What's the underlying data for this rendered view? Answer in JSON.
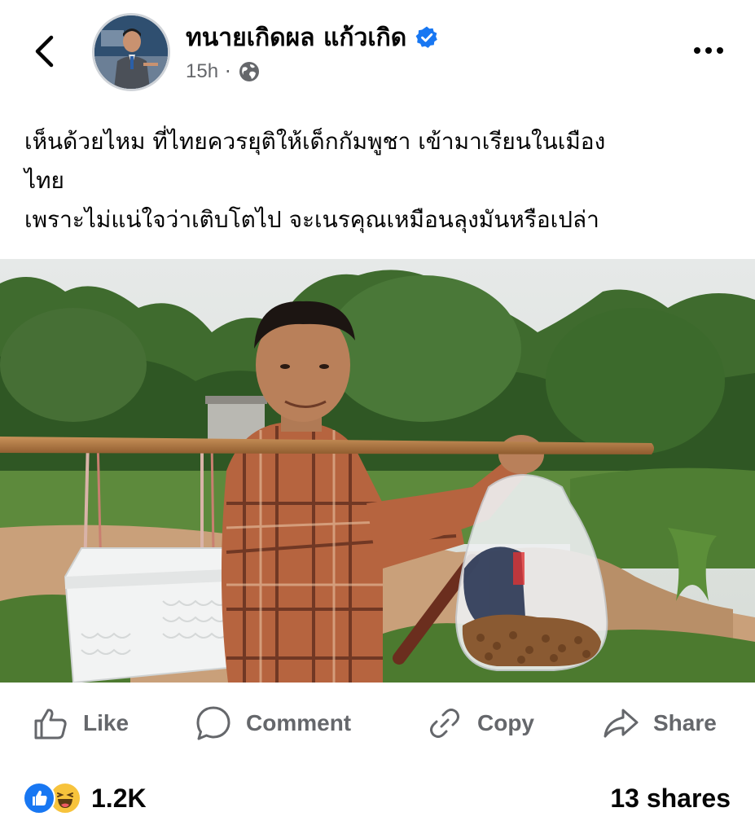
{
  "post": {
    "author": "ทนายเกิดผล แก้วเกิด",
    "time": "15h",
    "separator": "·",
    "lines": [
      "เห็นด้วยไหม ที่ไทยควรยุติให้เด็กกัมพูชา เข้ามาเรียนในเมือง",
      "ไทย",
      "เพราะไม่แน่ใจว่าเติบโตไป จะเนรคุณเหมือนลุงมันหรือเปล่า"
    ]
  },
  "actions": {
    "like": "Like",
    "comment": "Comment",
    "copy": "Copy",
    "share": "Share"
  },
  "stats": {
    "reactions": "1.2K",
    "shares": "13 shares"
  },
  "colors": {
    "verified": "#1877f2",
    "secondary_text": "#65676b",
    "like_blue": "#1877f2",
    "haha_yellow": "#f7c33c"
  },
  "icons": {
    "back": "chevron-left-icon",
    "more": "more-horizontal-icon",
    "verified": "verified-badge-icon",
    "audience": "globe-icon",
    "like": "thumbs-up-icon",
    "comment": "comment-bubble-icon",
    "copy": "link-icon",
    "share": "share-arrow-icon"
  }
}
